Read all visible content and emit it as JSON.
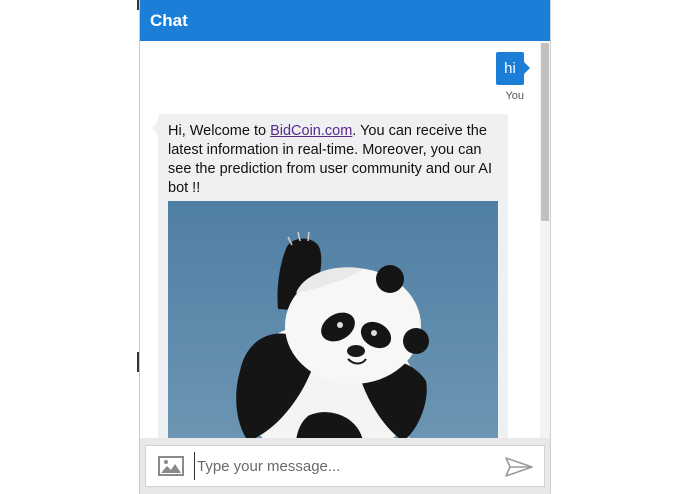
{
  "header": {
    "title": "Chat"
  },
  "messages": {
    "user": {
      "text": "hi",
      "sender_label": "You"
    },
    "bot": {
      "text_before_link": "Hi, Welcome to ",
      "link_text": "BidCoin.com",
      "text_after_link": ". You can receive the latest information in real-time. Moreover, you can see the prediction from user community and our AI bot !!",
      "image_icon": "panda-image"
    }
  },
  "composer": {
    "placeholder": "Type your message...",
    "value": "",
    "attach_icon": "image-icon",
    "send_icon": "send-icon"
  },
  "colors": {
    "header_bg": "#1b7fd8",
    "user_bubble_bg": "#1b7fd8",
    "bot_bubble_bg": "#eef0f2",
    "link_color": "#5b2a8e"
  }
}
